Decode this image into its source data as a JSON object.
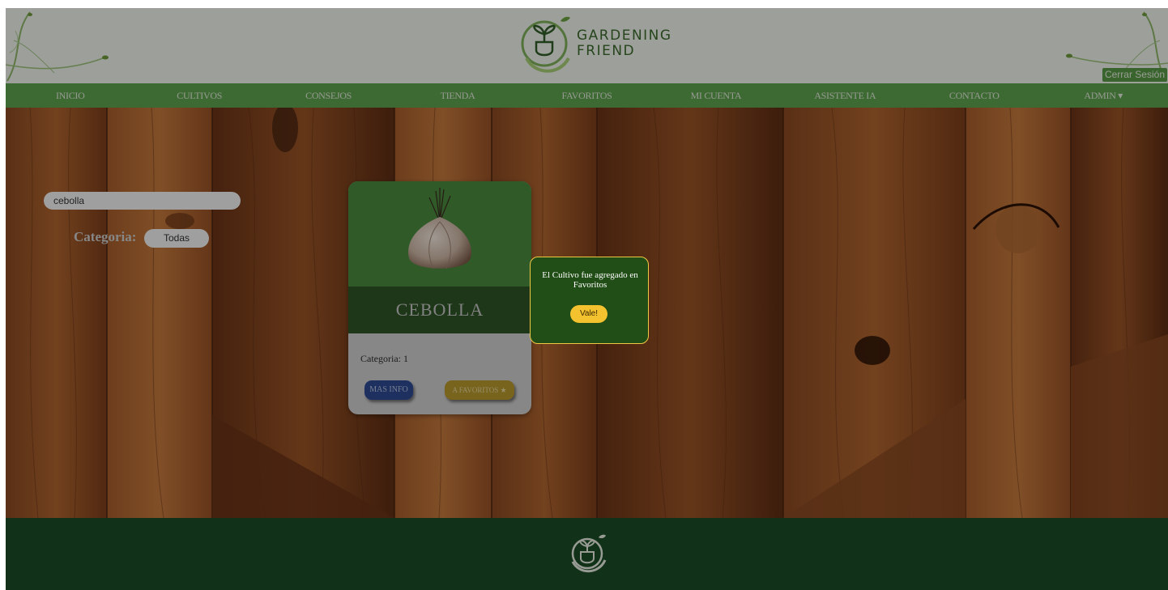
{
  "header": {
    "brand_line1": "GARDENING",
    "brand_line2": "FRIEND",
    "logout_label": "Cerrar Sesión"
  },
  "nav": {
    "items": [
      {
        "label": "INICIO"
      },
      {
        "label": "CULTIVOS"
      },
      {
        "label": "CONSEJOS"
      },
      {
        "label": "TIENDA"
      },
      {
        "label": "FAVORITOS"
      },
      {
        "label": "MI CUENTA"
      },
      {
        "label": "ASISTENTE IA"
      },
      {
        "label": "CONTACTO"
      },
      {
        "label": "ADMIN ▾"
      }
    ]
  },
  "filters": {
    "search_value": "cebolla",
    "category_label": "Categoria:",
    "category_selected": "Todas"
  },
  "card": {
    "title": "CEBOLLA",
    "category": "Categoria: 1",
    "info_button": "MAS INFO",
    "fav_button": "A FAVORITOS ★"
  },
  "modal": {
    "message": "El Cultivo fue agregado en Favoritos",
    "ok_button": "Vale!"
  },
  "colors": {
    "nav_green": "#5fa14d",
    "footer_green": "#1b4e25",
    "modal_green": "#214d17",
    "modal_border": "#f2c744",
    "info_blue": "#2d4a94",
    "fav_gold": "#b99a2d"
  },
  "icons": {
    "logo": "sprout-in-circle-icon",
    "footer_logo": "sprout-in-circle-icon",
    "card_image": "onion-image"
  }
}
